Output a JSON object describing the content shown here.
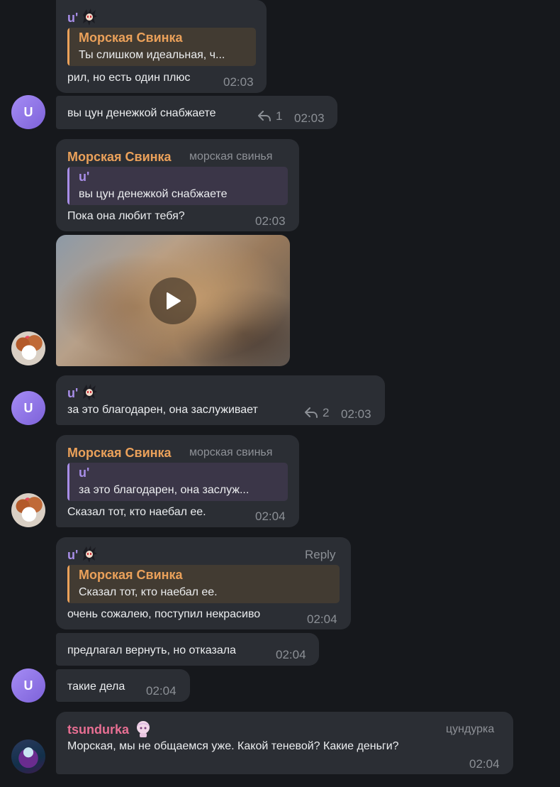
{
  "names": {
    "u": "u'",
    "pig": "Морская Свинка",
    "tsu": "tsundurka"
  },
  "ranks": {
    "pig": "морская свинья",
    "tsu": "цундурка"
  },
  "avatar_initial": "U",
  "messages": {
    "m1": {
      "quote_name": "Морская Свинка",
      "quote_text": "Ты слишком идеальная, ч...",
      "text": "рил, но есть один плюс",
      "time": "02:03"
    },
    "m2": {
      "text": "вы цун денежкой снабжаете",
      "reply_count": "1",
      "time": "02:03"
    },
    "m3": {
      "quote_name": "u'",
      "quote_text": "вы цун денежкой снабжаете",
      "text": "Пока она любит тебя?",
      "time": "02:03"
    },
    "m4": {
      "text": "за это благодарен, она заслуживает",
      "reply_count": "2",
      "time": "02:03"
    },
    "m5": {
      "quote_name": "u'",
      "quote_text": "за это благодарен, она заслуж...",
      "text": "Сказал тот, кто наебал ее.",
      "time": "02:04"
    },
    "m6": {
      "reply_label": "Reply",
      "quote_name": "Морская Свинка",
      "quote_text": "Сказал тот, кто наебал ее.",
      "text": "очень сожалею, поступил некрасиво",
      "time": "02:04"
    },
    "m7": {
      "text": "предлагал вернуть, но отказала",
      "time": "02:04"
    },
    "m8": {
      "text": "такие дела",
      "time": "02:04"
    },
    "m9": {
      "text": "Морская, мы не общаемся уже. Какой теневой? Какие деньги?",
      "time": "02:04"
    }
  },
  "icons": {
    "reply": "reply-arrow-icon",
    "play": "play-icon",
    "custom_emoji": "anime-character-emoji-icon"
  }
}
